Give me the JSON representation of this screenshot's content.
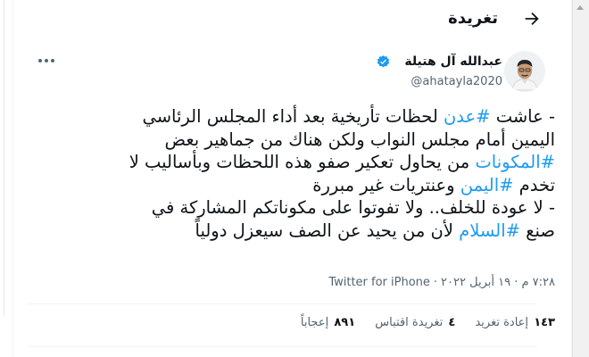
{
  "header": {
    "title": "تغريدة"
  },
  "author": {
    "name": "عبدالله آل هتيلة",
    "handle": "@ahatayla2020"
  },
  "colors": {
    "accent": "#1d9bf0",
    "text": "#0f1419",
    "muted": "#536471"
  },
  "tweet": {
    "lines": [
      [
        {
          "t": "- عاشت ",
          "tag": false
        },
        {
          "t": "#عدن",
          "tag": true
        },
        {
          "t": " لحظات تأريخية بعد أداء المجلس الرئاسي",
          "tag": false
        }
      ],
      [
        {
          "t": "اليمين أمام مجلس النواب ولكن هناك من جماهير بعض",
          "tag": false
        }
      ],
      [
        {
          "t": "#المكونات",
          "tag": true
        },
        {
          "t": " من يحاول تعكير صفو هذه اللحظات وبأساليب لا",
          "tag": false
        }
      ],
      [
        {
          "t": "تخدم ",
          "tag": false
        },
        {
          "t": "#اليمن",
          "tag": true
        },
        {
          "t": " وعنتريات غير مبررة",
          "tag": false
        }
      ],
      [
        {
          "t": "- لا عودة للخلف.. ولا تفوتوا على مكوناتكم المشاركة في",
          "tag": false
        }
      ],
      [
        {
          "t": "صنع ",
          "tag": false
        },
        {
          "t": "#السلام",
          "tag": true
        },
        {
          "t": " لأن من يحيد عن الصف سيعزل دولياً",
          "tag": false
        }
      ]
    ]
  },
  "meta": {
    "time": "٧:٢٨ م · ١٩ أبريل ٢٠٢٢",
    "separator": "·",
    "source": "Twitter for iPhone"
  },
  "stats": [
    {
      "num": "١٤٣",
      "label": "إعادة تغريد"
    },
    {
      "num": "٤",
      "label": "تغريدة اقتباس"
    },
    {
      "num": "٨٩١",
      "label": "إعجاباً"
    }
  ],
  "icons": {
    "back": "arrow-left-icon",
    "verified": "verified-badge-icon",
    "more": "more-icon"
  }
}
